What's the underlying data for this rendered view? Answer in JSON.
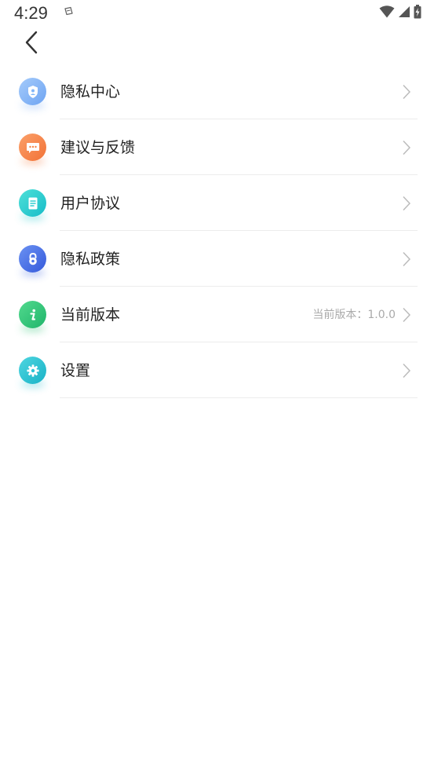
{
  "status_bar": {
    "time": "4:29",
    "notification_icon": "notification-icon",
    "wifi_icon": "wifi-icon",
    "signal_icon": "signal-icon",
    "battery_icon": "battery-charging-icon"
  },
  "header": {
    "back_icon": "chevron-left-icon"
  },
  "menu": {
    "items": [
      {
        "label": "隐私中心",
        "value": "",
        "icon": "privacy-center-icon",
        "color": "#82b6f7"
      },
      {
        "label": "建议与反馈",
        "value": "",
        "icon": "feedback-chat-icon",
        "color": "#f6874a"
      },
      {
        "label": "用户协议",
        "value": "",
        "icon": "document-icon",
        "color": "#2fcfd0"
      },
      {
        "label": "隐私政策",
        "value": "",
        "icon": "lock-icon",
        "color": "#4b72ea"
      },
      {
        "label": "当前版本",
        "value": "当前版本：1.0.0",
        "icon": "info-icon",
        "color": "#2cc57b"
      },
      {
        "label": "设置",
        "value": "",
        "icon": "gear-icon",
        "color": "#2cc5d6"
      }
    ]
  },
  "colors": {
    "text_primary": "#222222",
    "text_secondary": "#aaaaaa",
    "divider": "#ececec",
    "chevron": "#bbbbbb"
  }
}
